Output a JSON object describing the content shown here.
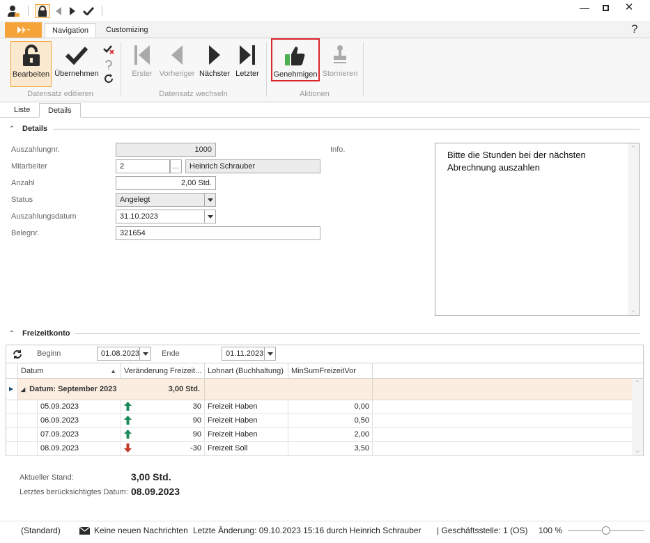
{
  "ribbon_tabs": [
    "Navigation",
    "Customizing"
  ],
  "help_label": "?",
  "ribbon": {
    "bearbeiten": "Bearbeiten",
    "uebernehmen": "Übernehmen",
    "erster": "Erster",
    "vorheriger": "Vorheriger",
    "naechster": "Nächster",
    "letzter": "Letzter",
    "genehmigen": "Genehmigen",
    "stornieren": "Stornieren",
    "group_edit": "Datensatz editieren",
    "group_nav": "Datensatz wechseln",
    "group_actions": "Aktionen"
  },
  "view_tabs": [
    "Liste",
    "Details"
  ],
  "details": {
    "section_title": "Details",
    "fields": {
      "auszahlungnr_label": "Auszahlungnr.",
      "auszahlungnr_value": "1000",
      "mitarbeiter_label": "Mitarbeiter",
      "mitarbeiter_id": "2",
      "mitarbeiter_btn": "...",
      "mitarbeiter_name": "Heinrich Schrauber",
      "anzahl_label": "Anzahl",
      "anzahl_value": "2,00 Std.",
      "status_label": "Status",
      "status_value": "Angelegt",
      "datum_label": "Auszahlungsdatum",
      "datum_value": "31.10.2023",
      "belegnr_label": "Belegnr.",
      "belegnr_value": "321654",
      "info_label": "Info.",
      "info_text": "Bitte die Stunden bei der nächsten Abrechnung auszahlen"
    }
  },
  "freizeit": {
    "section_title": "Freizeitkonto",
    "beginn_label": "Beginn",
    "beginn_value": "01.08.2023",
    "ende_label": "Ende",
    "ende_value": "01.11.2023",
    "columns": [
      "Datum",
      "Veränderung Freizeit...",
      "Lohnart (Buchhaltung)",
      "MinSumFreizeitVor"
    ],
    "group_label": "Datum: September 2023",
    "group_sum": "3,00 Std.",
    "rows": [
      {
        "datum": "05.09.2023",
        "dir": "up",
        "change": "30",
        "lohnart": "Freizeit Haben",
        "min": "0,00"
      },
      {
        "datum": "06.09.2023",
        "dir": "up",
        "change": "90",
        "lohnart": "Freizeit Haben",
        "min": "0,50"
      },
      {
        "datum": "07.09.2023",
        "dir": "up",
        "change": "90",
        "lohnart": "Freizeit Haben",
        "min": "2,00"
      },
      {
        "datum": "08.09.2023",
        "dir": "down",
        "change": "-30",
        "lohnart": "Freizeit Soll",
        "min": "3,50"
      }
    ],
    "aktueller_label": "Aktueller Stand:",
    "aktueller_value": "3,00 Std.",
    "letztes_label": "Letztes berücksichtigtes Datum:",
    "letztes_value": "08.09.2023"
  },
  "status_bar": {
    "standard": "(Standard)",
    "messages": "Keine neuen Nachrichten",
    "last_change": "Letzte Änderung: 09.10.2023 15:16 durch Heinrich Schrauber",
    "branch": "| Geschäftsstelle:  1 (OS)",
    "zoom": "100 %",
    "zoom_level": 0.5
  },
  "colors": {
    "accent": "#f5a43a",
    "highlight_red": "#d9262b",
    "up_arrow": "#1e8a5a",
    "down_arrow": "#c0392b",
    "group_row_bg": "#fbeee0",
    "approve_icon_green": "#4caf50"
  }
}
